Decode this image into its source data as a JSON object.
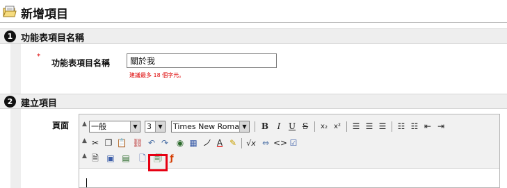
{
  "page": {
    "title": "新增項目"
  },
  "sections": [
    {
      "number": "1",
      "title": "功能表項目名稱"
    },
    {
      "number": "2",
      "title": "建立項目"
    }
  ],
  "menu_name_field": {
    "required_mark": "*",
    "label": "功能表項目名稱",
    "value": "關於我",
    "hint": "建議最多 18 個字元。"
  },
  "editor": {
    "label": "頁面",
    "format_select": "一般",
    "size_select": "3",
    "font_select": "Times New Roman",
    "highlight_color": "#e60012"
  },
  "icons": {
    "row1": [
      "bold-icon",
      "italic-icon",
      "underline-icon",
      "strikethrough-icon",
      "subscript-icon",
      "superscript-icon",
      "align-left-icon",
      "align-center-icon",
      "align-right-icon",
      "ordered-list-icon",
      "unordered-list-icon",
      "outdent-icon",
      "indent-icon"
    ],
    "row2": [
      "cut-icon",
      "copy-icon",
      "paste-icon",
      "unlink-icon",
      "undo-icon",
      "redo-icon",
      "link-icon",
      "table-icon",
      "text-style-icon",
      "font-color-icon",
      "highlight-icon",
      "formula-icon",
      "media-icon",
      "html-source-icon",
      "check-icon"
    ],
    "row3": [
      "doc-icon",
      "image-icon",
      "gallery-icon",
      "page-icon",
      "insert-file-icon",
      "flash-icon"
    ]
  }
}
